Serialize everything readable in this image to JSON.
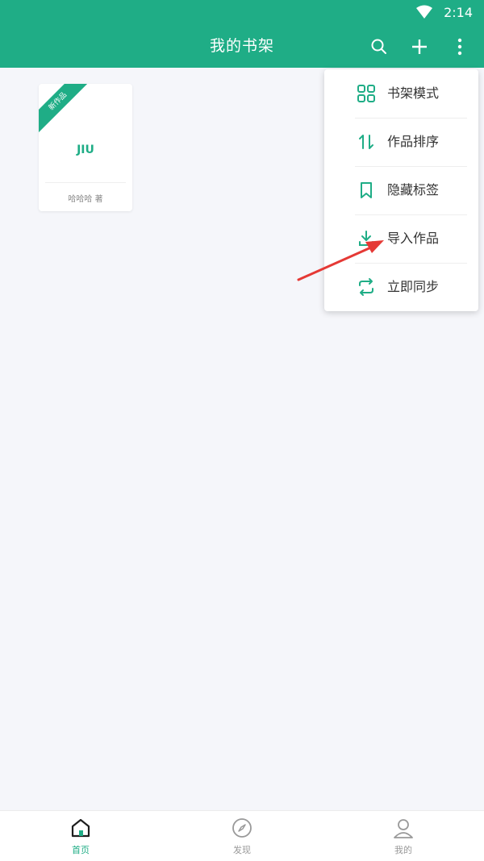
{
  "status_bar": {
    "time": "2:14",
    "wifi_icon": "wifi-icon"
  },
  "app_bar": {
    "title": "我的书架",
    "icons": [
      "search-icon",
      "add-icon",
      "more-vertical-icon"
    ]
  },
  "book": {
    "ribbon": "新作品",
    "title": "JIU",
    "author": "哈哈哈 著"
  },
  "menu": {
    "items": [
      {
        "label": "书架模式",
        "icon": "grid-icon"
      },
      {
        "label": "作品排序",
        "icon": "sort-icon"
      },
      {
        "label": "隐藏标签",
        "icon": "bookmark-icon"
      },
      {
        "label": "导入作品",
        "icon": "download-icon"
      },
      {
        "label": "立即同步",
        "icon": "sync-icon"
      }
    ]
  },
  "bottom_nav": {
    "items": [
      {
        "label": "首页",
        "icon": "home-icon",
        "active": true
      },
      {
        "label": "发现",
        "icon": "compass-icon",
        "active": false
      },
      {
        "label": "我的",
        "icon": "person-icon",
        "active": false
      }
    ]
  },
  "colors": {
    "accent": "#1fad86",
    "annotation": "#e53935",
    "background": "#f5f6fa"
  }
}
